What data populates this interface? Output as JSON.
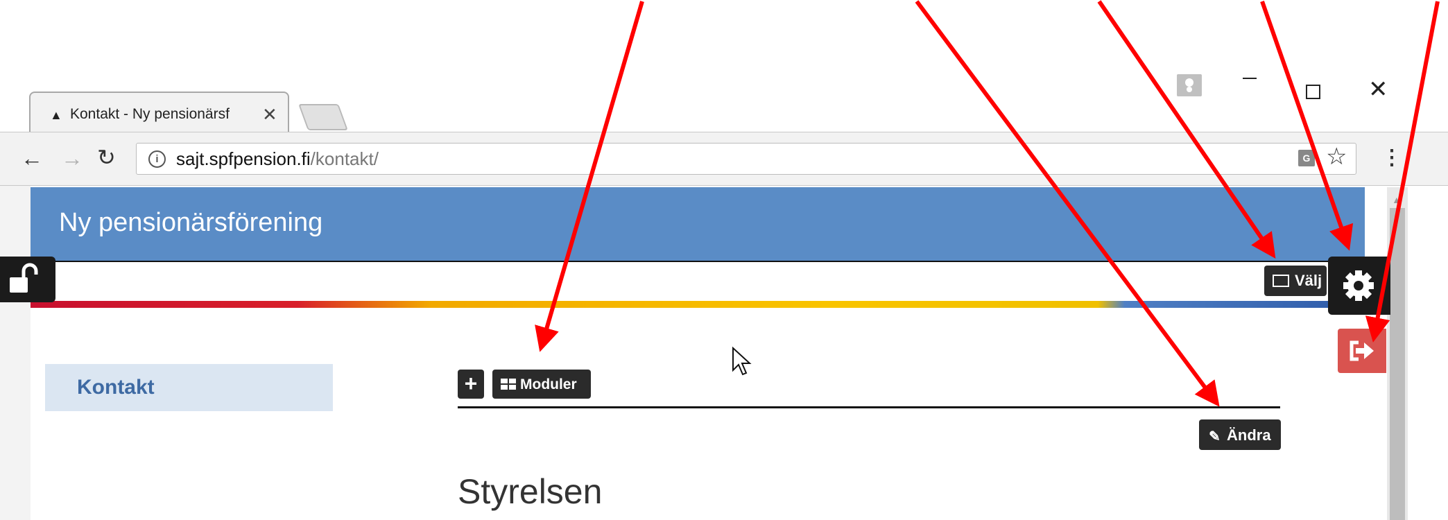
{
  "browser": {
    "tab_title": "Kontakt - Ny pensionärsf",
    "tab_close": "✕",
    "url_host": "sajt.spfpension.fi",
    "url_path": "/kontakt/"
  },
  "site": {
    "title": "Ny pensionärsförening"
  },
  "admin": {
    "valj_label": "Välj",
    "moduler_label": "Moduler",
    "add_label": "+",
    "andra_label": "Ändra"
  },
  "sidebar": {
    "items": [
      {
        "label": "Kontakt"
      }
    ]
  },
  "main": {
    "heading": "Styrelsen"
  },
  "colors": {
    "header_blue": "#5a8cc6",
    "admin_dark": "#1b1b1b",
    "logout_red": "#d9534f",
    "annotation_red": "#ff0000",
    "sidebar_bg": "#dbe6f2"
  },
  "icons": [
    "home-icon",
    "info-icon",
    "translate-icon",
    "star-icon",
    "menu-icon",
    "unlock-icon",
    "gear-icon",
    "logout-icon",
    "image-icon",
    "grid-icon",
    "pencil-icon",
    "cursor-icon"
  ]
}
